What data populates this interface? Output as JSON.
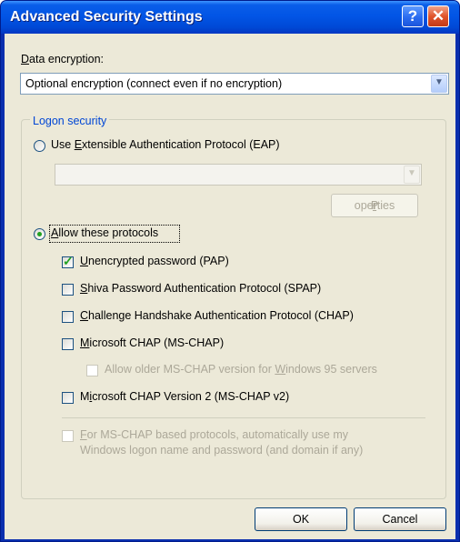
{
  "window": {
    "title": "Advanced Security Settings",
    "help_glyph": "?",
    "close_glyph": "✕"
  },
  "data_encryption": {
    "label_first": "D",
    "label_rest": "ata encryption:",
    "value": "Optional encryption (connect even if no encryption)",
    "arrow_glyph": "▼"
  },
  "logon_security": {
    "group_title": "Logon security",
    "eap_radio": {
      "pre": "Use ",
      "u": "E",
      "post": "xtensible Authentication Protocol (EAP)",
      "selected": false
    },
    "eap_combo": {
      "value": "",
      "arrow_glyph": "▼"
    },
    "properties_button": {
      "pre": "P",
      "u": "r",
      "post": "operties"
    },
    "allow_radio": {
      "pre": "",
      "u": "A",
      "post": "llow these protocols",
      "selected": true
    },
    "protocols": [
      {
        "pre": "",
        "u": "U",
        "post": "nencrypted password (PAP)",
        "checked": true,
        "enabled": true
      },
      {
        "pre": "",
        "u": "S",
        "post": "hiva Password Authentication Protocol (SPAP)",
        "checked": false,
        "enabled": true
      },
      {
        "pre": "",
        "u": "C",
        "post": "hallenge Handshake Authentication Protocol (CHAP)",
        "checked": false,
        "enabled": true
      },
      {
        "pre": "",
        "u": "M",
        "post": "icrosoft CHAP (MS-CHAP)",
        "checked": false,
        "enabled": true
      },
      {
        "pre": "Allow older MS-CHAP version for ",
        "u": "W",
        "post": "indows 95 servers",
        "checked": false,
        "enabled": false
      },
      {
        "pre": "M",
        "u": "i",
        "post": "crosoft CHAP Version 2 (MS-CHAP v2)",
        "checked": false,
        "enabled": true
      }
    ],
    "auto_logon": {
      "line1_u": "F",
      "line1_rest": "or MS-CHAP based protocols, automatically use my",
      "line2": "Windows logon name and password (and domain if any)",
      "checked": false,
      "enabled": false
    }
  },
  "buttons": {
    "ok": "OK",
    "cancel": "Cancel"
  },
  "colors": {
    "title_bar": "#0255e6",
    "dialog_face": "#ece9d8",
    "group_title": "#0046d5",
    "check_mark": "#21a121",
    "disabled_text": "#aca899"
  }
}
